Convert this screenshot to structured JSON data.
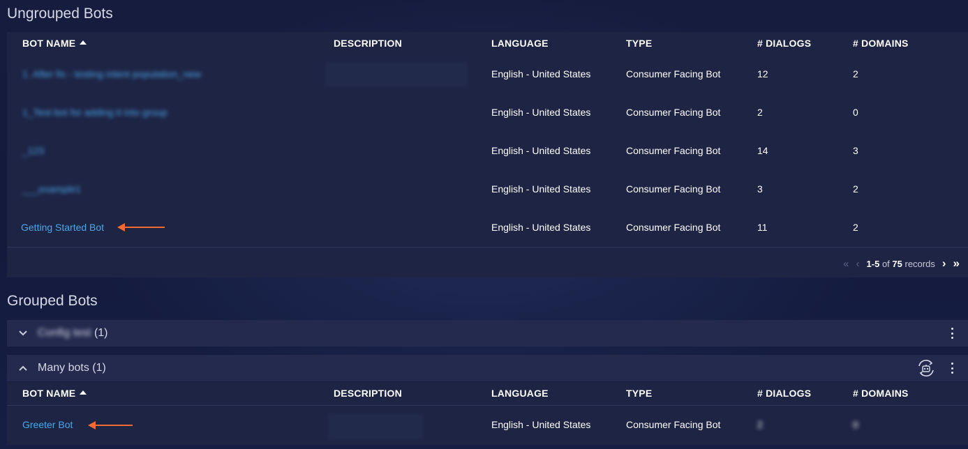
{
  "ungrouped": {
    "title": "Ungrouped Bots",
    "columns": {
      "bot_name": "BOT NAME",
      "description": "DESCRIPTION",
      "language": "LANGUAGE",
      "type": "TYPE",
      "dialogs": "# DIALOGS",
      "domains": "# DOMAINS"
    },
    "rows": [
      {
        "name": "1. After fix - testing intent population_new",
        "language": "English - United States",
        "type": "Consumer Facing Bot",
        "dialogs": "12",
        "domains": "2"
      },
      {
        "name": "1_Test bot for adding it into group",
        "language": "English - United States",
        "type": "Consumer Facing Bot",
        "dialogs": "2",
        "domains": "0"
      },
      {
        "name": "_123",
        "language": "English - United States",
        "type": "Consumer Facing Bot",
        "dialogs": "14",
        "domains": "3"
      },
      {
        "name": "___example1",
        "language": "English - United States",
        "type": "Consumer Facing Bot",
        "dialogs": "3",
        "domains": "2"
      },
      {
        "name": "Getting Started Bot",
        "language": "English - United States",
        "type": "Consumer Facing Bot",
        "dialogs": "11",
        "domains": "2"
      }
    ],
    "pagination": {
      "range": "1-5",
      "of": "of",
      "total": "75",
      "suffix": "records"
    }
  },
  "grouped": {
    "title": "Grouped Bots",
    "groups": [
      {
        "name": "Config test",
        "count": "(1)",
        "expanded": false
      },
      {
        "name": "Many bots",
        "count": "(1)",
        "expanded": true,
        "columns": {
          "bot_name": "BOT NAME",
          "description": "DESCRIPTION",
          "language": "LANGUAGE",
          "type": "TYPE",
          "dialogs": "# DIALOGS",
          "domains": "# DOMAINS"
        },
        "rows": [
          {
            "name": "Greeter Bot",
            "language": "English - United States",
            "type": "Consumer Facing Bot",
            "dialogs": "2",
            "domains": "0"
          }
        ]
      }
    ]
  },
  "colors": {
    "link": "#4aa8ea",
    "annotation_arrow": "#f46a32",
    "panel": "#1e2444"
  }
}
